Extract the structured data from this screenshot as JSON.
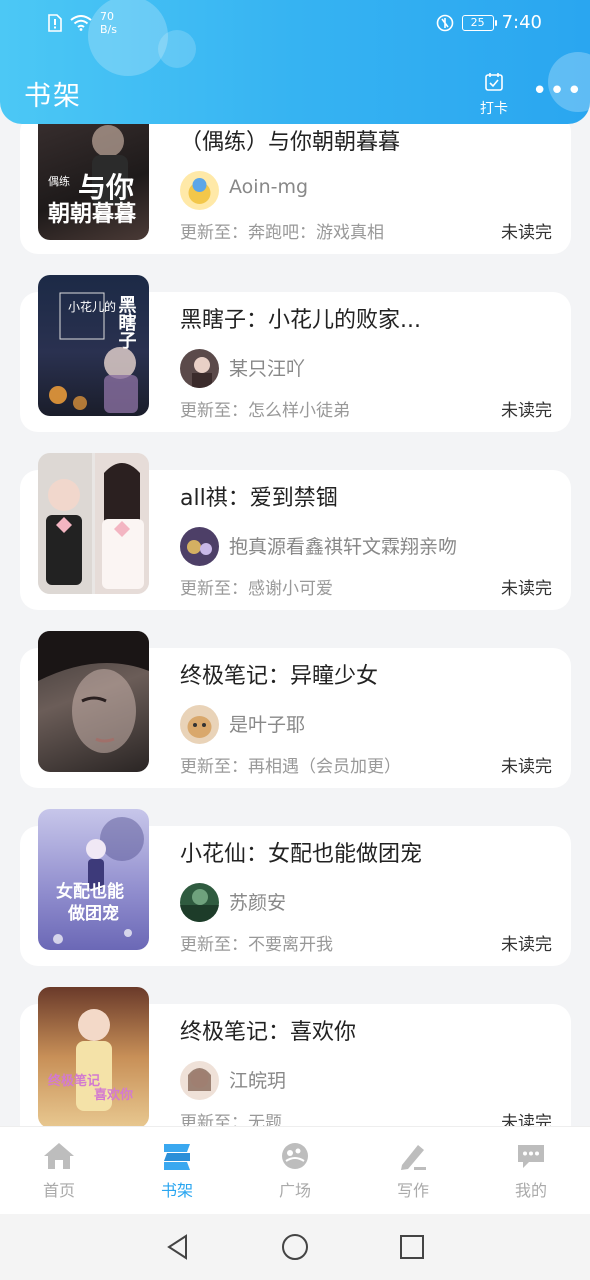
{
  "status_bar": {
    "speed_value": "70",
    "speed_unit": "B/s",
    "battery": "25",
    "time": "7:40"
  },
  "header": {
    "title": "书架",
    "checkin_label": "打卡",
    "more_label": "•••"
  },
  "books": [
    {
      "title": "（偶练）与你朝朝暮暮",
      "author": "Aoin-mg",
      "update": "更新至：奔跑吧：游戏真相",
      "status": "未读完",
      "cover_texts": [
        "偶练",
        "与你",
        "朝朝暮暮"
      ]
    },
    {
      "title": "黑瞎子：小花儿的败家...",
      "author": "某只汪吖",
      "update": "更新至：怎么样小徒弟",
      "status": "未读完",
      "cover_texts": [
        "黑瞎子",
        "小花儿的"
      ]
    },
    {
      "title": "all祺：爱到禁锢",
      "author": "抱真源看鑫祺轩文霖翔亲吻",
      "update": "更新至：感谢小可爱",
      "status": "未读完",
      "cover_texts": []
    },
    {
      "title": "终极笔记：异瞳少女",
      "author": "是叶子耶",
      "update": "更新至：再相遇（会员加更）",
      "status": "未读完",
      "cover_texts": []
    },
    {
      "title": "小花仙：女配也能做团宠",
      "author": "苏颜安",
      "update": "更新至：不要离开我",
      "status": "未读完",
      "cover_texts": [
        "女配也能",
        "做团宠"
      ]
    },
    {
      "title": "终极笔记：喜欢你",
      "author": "江皖玥",
      "update": "更新至：无题",
      "status": "未读完",
      "cover_texts": [
        "终极笔记",
        "喜欢你"
      ]
    }
  ],
  "tabs": [
    {
      "label": "首页",
      "icon": "home-icon"
    },
    {
      "label": "书架",
      "icon": "bookshelf-icon"
    },
    {
      "label": "广场",
      "icon": "plaza-icon"
    },
    {
      "label": "写作",
      "icon": "pencil-icon"
    },
    {
      "label": "我的",
      "icon": "chat-bubble-icon"
    }
  ],
  "colors": {
    "header_start": "#4cc8f5",
    "header_end": "#2aa6f0",
    "active_tab": "#2aa6f0",
    "inactive_tab": "#aaaaaa"
  }
}
